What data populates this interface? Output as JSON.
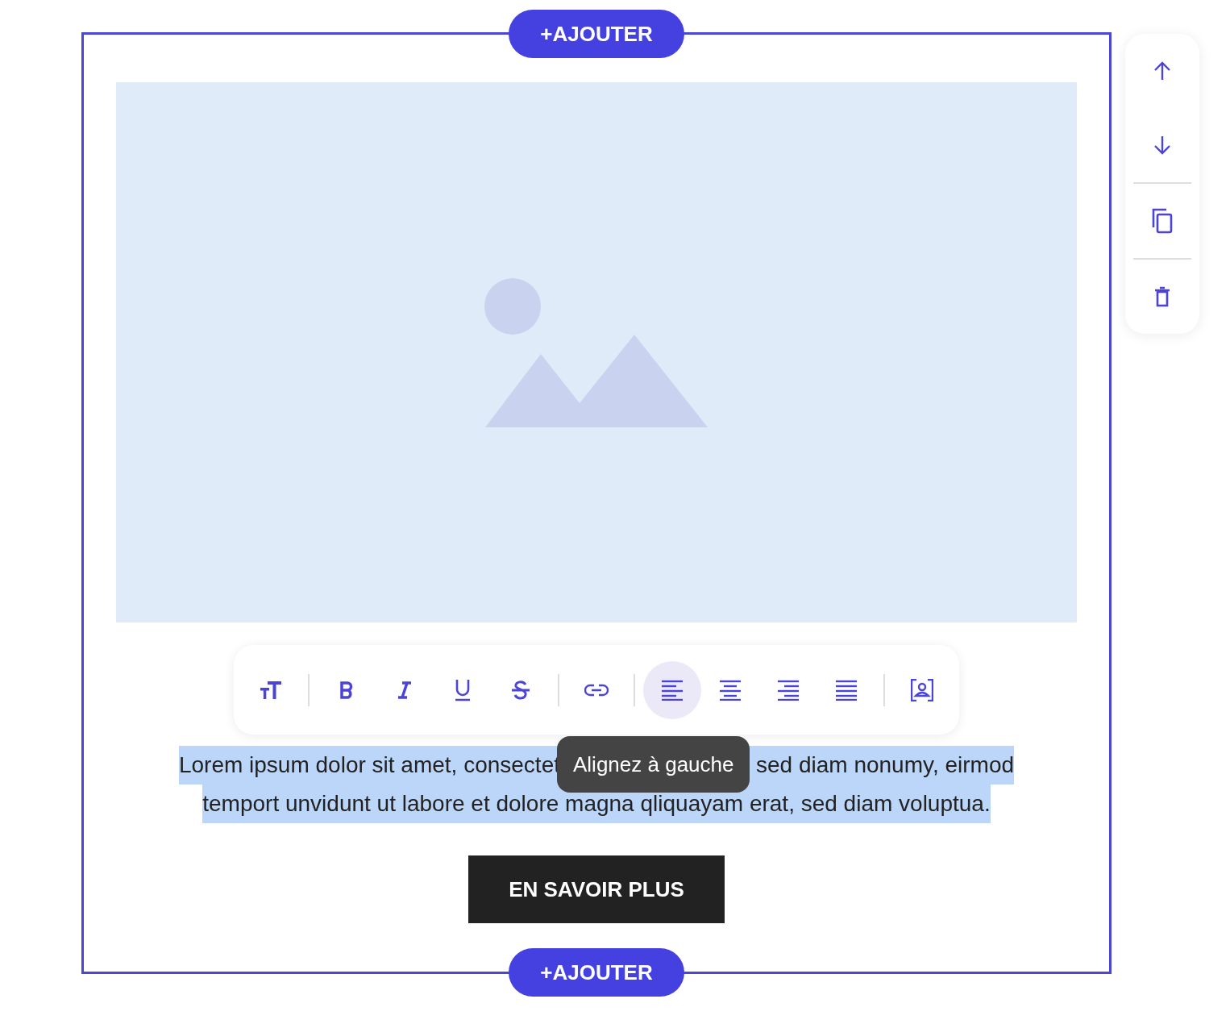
{
  "add_buttons": [
    "+AJOUTER",
    "+AJOUTER"
  ],
  "toolbar": {
    "groups": [
      [
        {
          "kind": "text-size",
          "selected": false
        }
      ],
      [
        {
          "kind": "bold",
          "selected": false
        },
        {
          "kind": "italic",
          "selected": false
        },
        {
          "kind": "underline",
          "selected": false
        },
        {
          "kind": "strikethrough",
          "selected": false
        }
      ],
      [
        {
          "kind": "link",
          "selected": false
        }
      ],
      [
        {
          "kind": "align-left",
          "selected": true
        },
        {
          "kind": "align-center",
          "selected": false
        },
        {
          "kind": "align-right",
          "selected": false
        },
        {
          "kind": "justify",
          "selected": false
        }
      ],
      [
        {
          "kind": "contact",
          "selected": false
        }
      ]
    ]
  },
  "tooltip": "Alignez à gauche",
  "paragraph": {
    "selected": true,
    "first_line": [
      "Lorem ipsum dolor sit amet, consectet",
      "sed diam nonumy, eirmod"
    ],
    "second_line": "temport unvidunt ut labore et dolore magna qliquayam erat, sed diam voluptua."
  },
  "cta_button": "EN SAVOIR PLUS",
  "side_actions": [
    {
      "kind": "move-up"
    },
    {
      "kind": "move-down"
    },
    {
      "kind": "duplicate"
    },
    {
      "kind": "delete"
    }
  ]
}
